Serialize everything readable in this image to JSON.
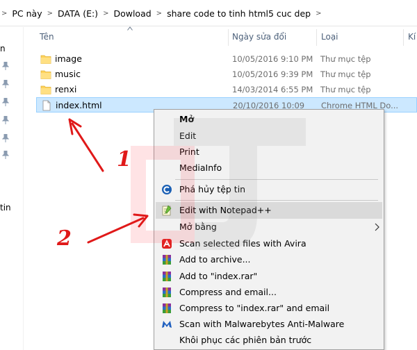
{
  "address_bar": {
    "crumbs": [
      "PC này",
      "DATA (E:)",
      "Dowload",
      "share code to tinh html5 cuc dep"
    ]
  },
  "nav_pane": {
    "visible_texts": [
      "n",
      "tin"
    ]
  },
  "columns": {
    "name": "Tên",
    "date": "Ngày sửa đổi",
    "type": "Loại",
    "size": "Kí"
  },
  "files": [
    {
      "name": "image",
      "date": "10/05/2016 9:10 PM",
      "type": "Thư mục tệp",
      "icon": "folder-icon"
    },
    {
      "name": "music",
      "date": "10/05/2016 9:39 PM",
      "type": "Thư mục tệp",
      "icon": "folder-icon"
    },
    {
      "name": "renxi",
      "date": "14/03/2014 6:55 PM",
      "type": "Thư mục tệp",
      "icon": "folder-icon"
    },
    {
      "name": "index.html",
      "date": "20/10/2016 10:09",
      "type": "Chrome HTML Do...",
      "icon": "html-file-icon",
      "selected": true
    }
  ],
  "context_menu": {
    "items": [
      {
        "label": "Mở",
        "bold": true
      },
      {
        "label": "Edit"
      },
      {
        "label": "Print"
      },
      {
        "label": "MediaInfo"
      },
      {
        "label": "Phá hủy tệp tin",
        "icon": "ccleaner-icon"
      },
      {
        "label": "Edit with Notepad++",
        "icon": "notepad-plus-icon",
        "highlighted": true
      },
      {
        "label": "Mở bằng",
        "has_submenu": true
      },
      {
        "label": "Scan selected files with Avira",
        "icon": "avira-icon"
      },
      {
        "label": "Add to archive...",
        "icon": "winrar-icon"
      },
      {
        "label": "Add to \"index.rar\"",
        "icon": "winrar-icon"
      },
      {
        "label": "Compress and email...",
        "icon": "winrar-icon"
      },
      {
        "label": "Compress to \"index.rar\" and email",
        "icon": "winrar-icon"
      },
      {
        "label": "Scan with Malwarebytes Anti-Malware",
        "icon": "malwarebytes-icon"
      },
      {
        "label": "Khôi phục các phiên bản trước"
      }
    ]
  },
  "annotations": {
    "step1": "1",
    "step2": "2",
    "color": "#e01919"
  },
  "colors": {
    "selection_bg": "#cce8ff",
    "selection_border": "#99d1ff",
    "menu_bg": "#f2f2f2",
    "folder": "#ffd35c",
    "header_text": "#4c607a"
  }
}
